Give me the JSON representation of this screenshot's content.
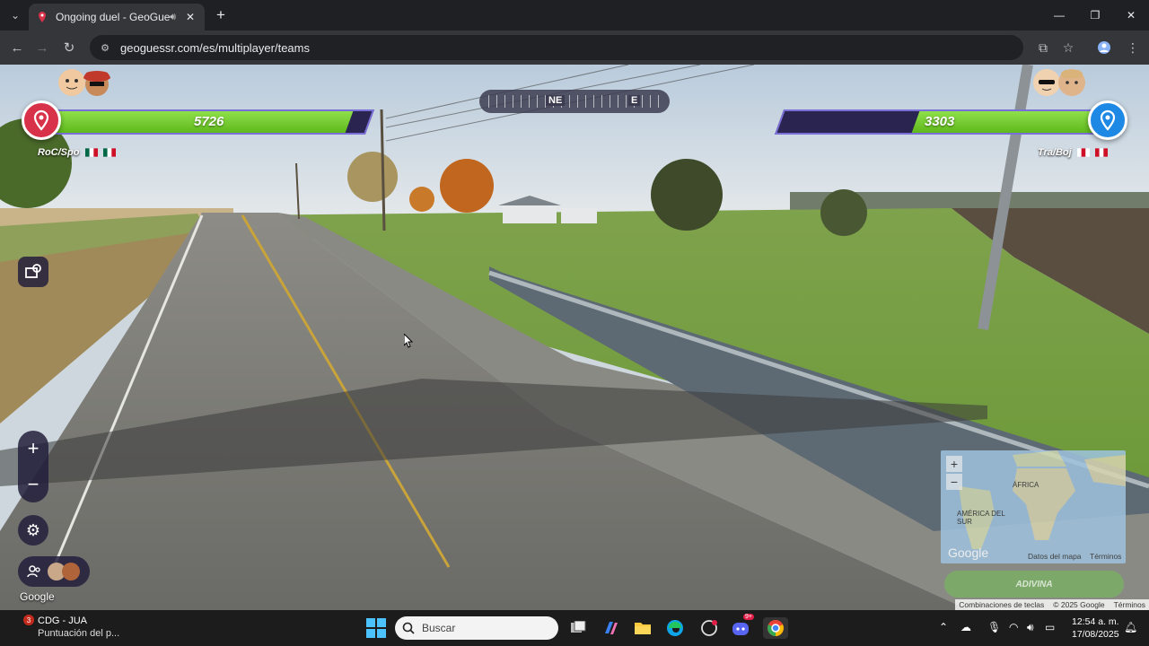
{
  "browser": {
    "tab_title": "Ongoing duel - GeoGuessr",
    "url": "geoguessr.com/es/multiplayer/teams"
  },
  "game": {
    "team_left": {
      "name": "RoC/Spo",
      "score": "5726",
      "health_fraction": 1.0
    },
    "team_right": {
      "name": "Tra/Boj",
      "score": "3303",
      "health_fraction": 0.58
    },
    "compass": {
      "primary": "NE",
      "secondary": "E"
    },
    "google_logo": "Google",
    "minimap": {
      "labels": {
        "africa": "ÁFRICA",
        "south_america": "AMÉRICA DEL SUR"
      },
      "google": "Google",
      "map_data": "Datos del mapa",
      "terms": "Términos"
    },
    "guess_button": "ADIVINA",
    "credits": {
      "shortcuts": "Combinaciones de teclas",
      "copyright": "© 2025 Google",
      "terms": "Términos"
    }
  },
  "taskbar": {
    "notification_count": "3",
    "notification_title": "CDG - JUA",
    "notification_sub": "Puntuación del p...",
    "search_placeholder": "Buscar",
    "time": "12:54 a. m.",
    "date": "17/08/2025",
    "discord_badge": "9+"
  },
  "colors": {
    "left_team": "#d8324a",
    "right_team": "#1e88e5",
    "health_green": "#7ad13a",
    "bar_dark": "#2a2450"
  }
}
